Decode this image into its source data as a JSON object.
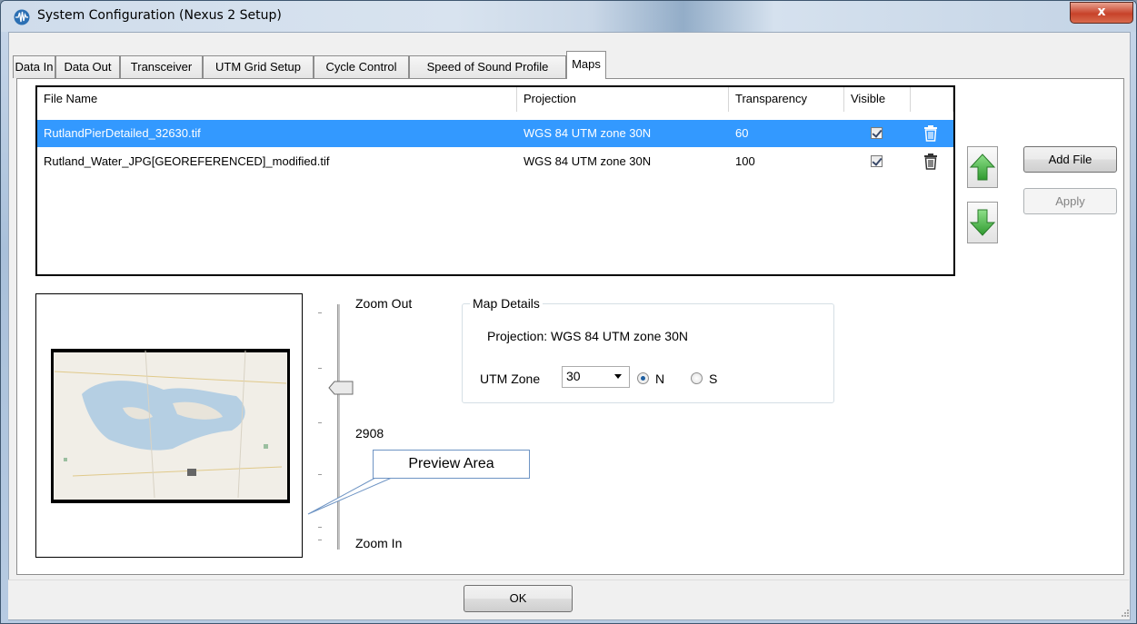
{
  "window": {
    "title": "System Configuration (Nexus 2 Setup)",
    "close_label": "x"
  },
  "tabs": [
    "Data In",
    "Data Out",
    "Transceiver",
    "UTM Grid Setup",
    "Cycle Control",
    "Speed of Sound Profile",
    "Maps"
  ],
  "active_tab": "Maps",
  "file_list": {
    "headers": {
      "file_name": "File Name",
      "projection": "Projection",
      "transparency": "Transparency",
      "visible": "Visible"
    },
    "rows": [
      {
        "file_name": "RutlandPierDetailed_32630.tif",
        "projection": "WGS 84 UTM zone 30N",
        "transparency": "60",
        "visible": true,
        "selected": true
      },
      {
        "file_name": "Rutland_Water_JPG[GEOREFERENCED]_modified.tif",
        "projection": "WGS 84 UTM zone 30N",
        "transparency": "100",
        "visible": true,
        "selected": false
      }
    ]
  },
  "buttons": {
    "add_file": "Add File",
    "apply": "Apply",
    "ok": "OK"
  },
  "icons": {
    "move_up": "green-up-arrow-icon",
    "move_down": "green-down-arrow-icon",
    "delete": "trash-icon"
  },
  "zoom": {
    "zoom_out_label": "Zoom Out",
    "zoom_in_label": "Zoom In",
    "value": "2908"
  },
  "map_details": {
    "group_label": "Map Details",
    "projection_text": "Projection: WGS 84 UTM zone 30N",
    "utm_zone_label": "UTM Zone",
    "utm_zone_value": "30",
    "hemisphere_n": "N",
    "hemisphere_s": "S",
    "hemisphere_selected": "N"
  },
  "callout": {
    "text": "Preview Area"
  },
  "colors": {
    "selection": "#3399ff",
    "arrow_green": "#3aa63a",
    "close_red": "#c7422a"
  }
}
